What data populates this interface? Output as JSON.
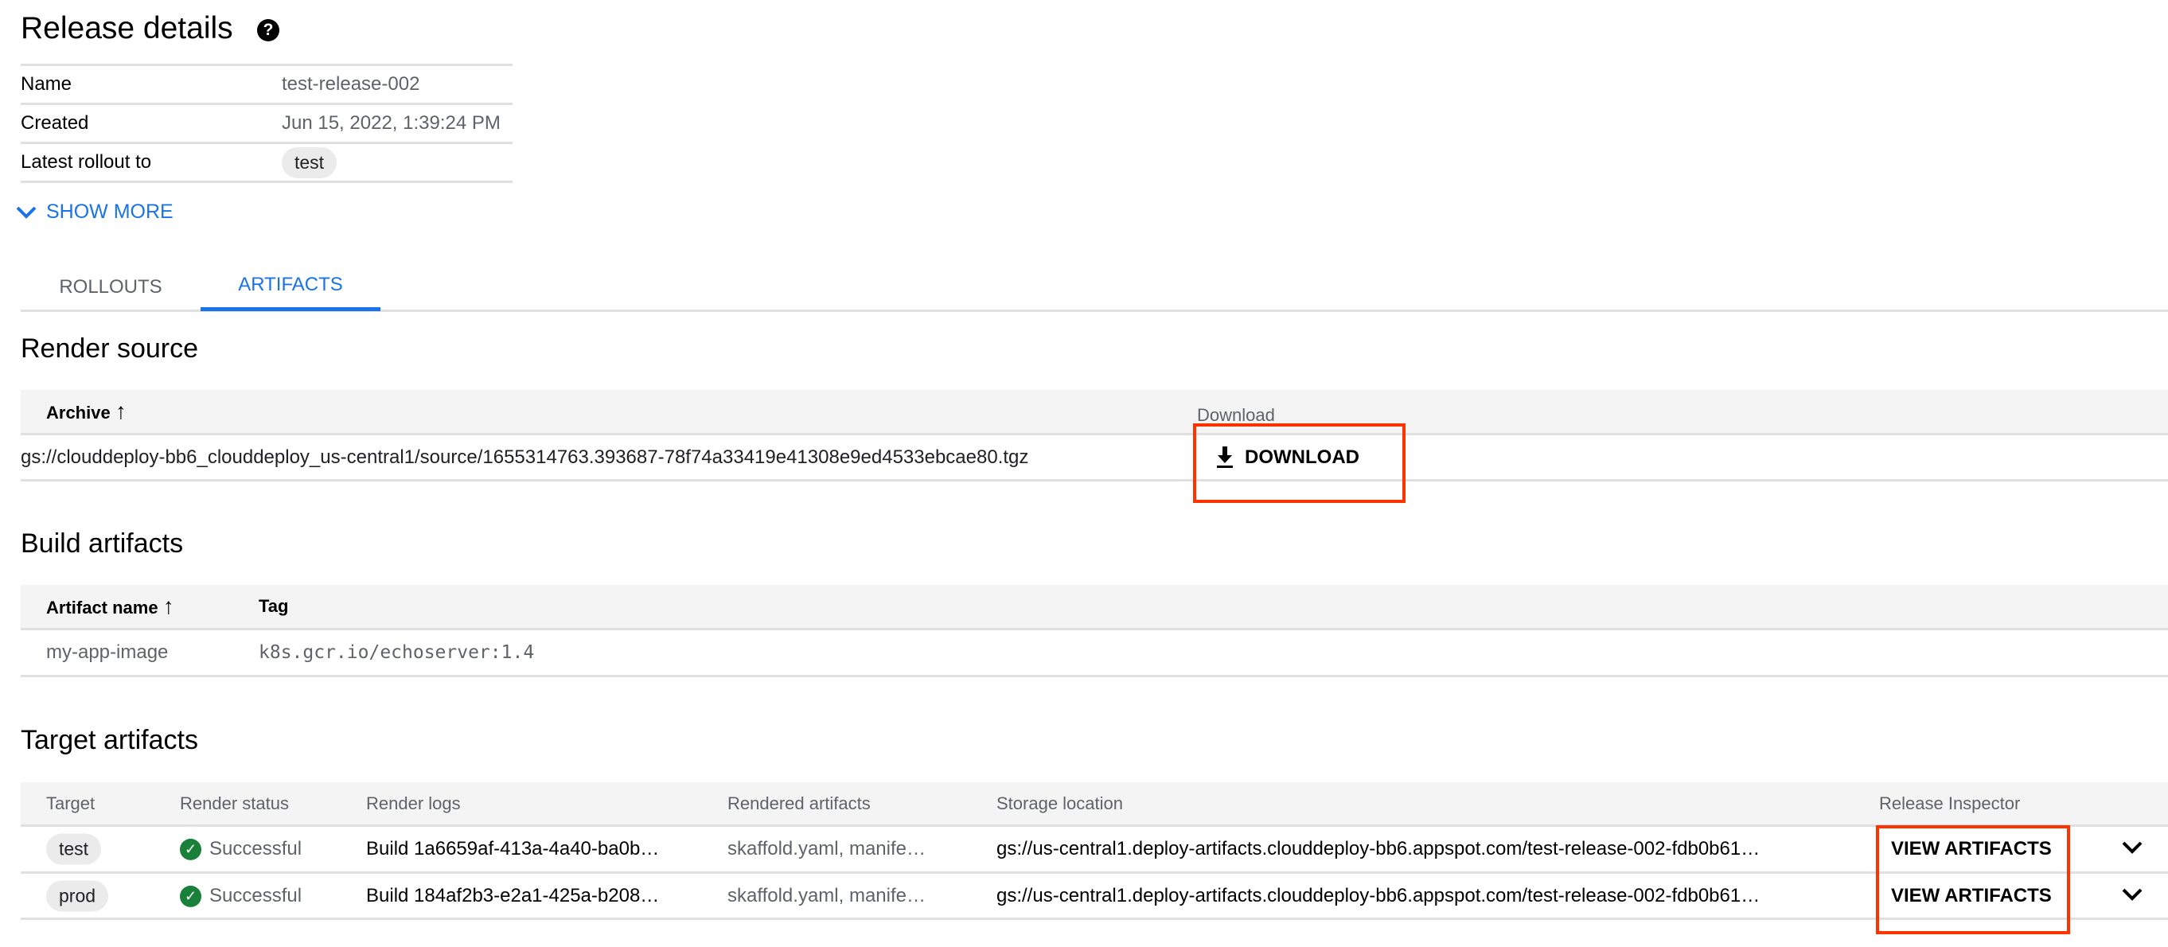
{
  "header": {
    "title": "Release details",
    "help_icon": "help-circle-icon"
  },
  "details": [
    {
      "label": "Name",
      "value": "test-release-002"
    },
    {
      "label": "Created",
      "value": "Jun 15, 2022, 1:39:24 PM"
    },
    {
      "label": "Latest rollout to",
      "value": "test"
    }
  ],
  "show_more": "SHOW MORE",
  "tabs": [
    {
      "label": "ROLLOUTS"
    },
    {
      "label": "ARTIFACTS",
      "active": true
    }
  ],
  "render_source": {
    "title": "Render source",
    "columns": [
      "Archive",
      "Download"
    ],
    "rows": [
      {
        "archive": "gs://clouddeploy-bb6_clouddeploy_us-central1/source/1655314763.393687-78f74a33419e41308e9ed4533ebcae80.tgz",
        "download": "DOWNLOAD"
      }
    ]
  },
  "build_artifacts": {
    "title": "Build artifacts",
    "columns": [
      "Artifact name",
      "Tag"
    ],
    "rows": [
      {
        "name": "my-app-image",
        "tag": "k8s.gcr.io/echoserver:1.4"
      }
    ]
  },
  "target_artifacts": {
    "title": "Target artifacts",
    "columns": [
      "Target",
      "Render status",
      "Render logs",
      "Rendered artifacts",
      "Storage location",
      "Release Inspector"
    ],
    "rows": [
      {
        "target": "test",
        "status": "Successful",
        "logs": "Build 1a6659af-413a-4a40-ba0b…",
        "rendered": "skaffold.yaml, manife…",
        "storage": "gs://us-central1.deploy-artifacts.clouddeploy-bb6.appspot.com/test-release-002-fdb0b61…",
        "action": "VIEW ARTIFACTS"
      },
      {
        "target": "prod",
        "status": "Successful",
        "logs": "Build 184af2b3-e2a1-425a-b208…",
        "rendered": "skaffold.yaml, manife…",
        "storage": "gs://us-central1.deploy-artifacts.clouddeploy-bb6.appspot.com/test-release-002-fdb0b61…",
        "action": "VIEW ARTIFACTS"
      }
    ]
  },
  "colors": {
    "accent": "#1a73e8",
    "success": "#188038",
    "highlight": "#ff3300"
  }
}
